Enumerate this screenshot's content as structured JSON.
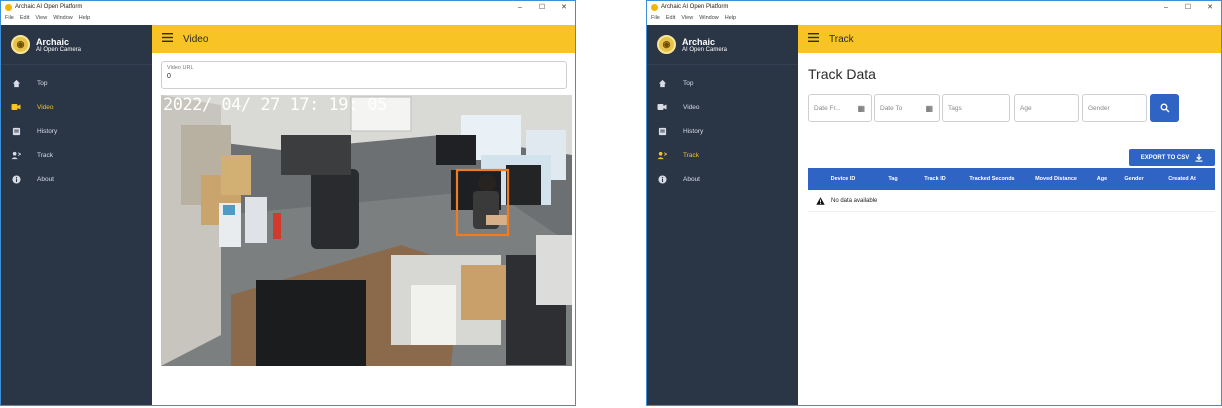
{
  "window": {
    "title": "Archaic AI Open Platform",
    "menu": [
      "File",
      "Edit",
      "View",
      "Window",
      "Help"
    ],
    "controls": [
      "–",
      "☐",
      "✕"
    ]
  },
  "brand": {
    "name": "Archaic",
    "sub": "AI Open Camera"
  },
  "nav": [
    {
      "label": "Top",
      "icon": "home-icon"
    },
    {
      "label": "Video",
      "icon": "videocam-icon"
    },
    {
      "label": "History",
      "icon": "history-icon"
    },
    {
      "label": "Track",
      "icon": "track-person-icon"
    },
    {
      "label": "About",
      "icon": "info-icon"
    }
  ],
  "video_page": {
    "header": "Video",
    "url_label": "Video URL",
    "url_value": "0",
    "timestamp": "2022/ 04/ 27   17: 19: 05",
    "active_nav": "Video"
  },
  "track_page": {
    "header": "Track",
    "title": "Track Data",
    "filters": {
      "date_from": "Date Fr...",
      "date_to": "Date To",
      "tags": "Tags",
      "age": "Age",
      "gender": "Gender"
    },
    "export_label": "EXPORT TO CSV",
    "columns": [
      "Device ID",
      "Tag",
      "Track ID",
      "Tracked Seconds",
      "Moved Distance",
      "Age",
      "Gender",
      "Created At"
    ],
    "no_data": "No data available",
    "active_nav": "Track"
  },
  "colors": {
    "accent": "#f7c325",
    "sidebar": "#2a3546",
    "primary": "#2f64c4",
    "detection_box": "#f07c22"
  }
}
